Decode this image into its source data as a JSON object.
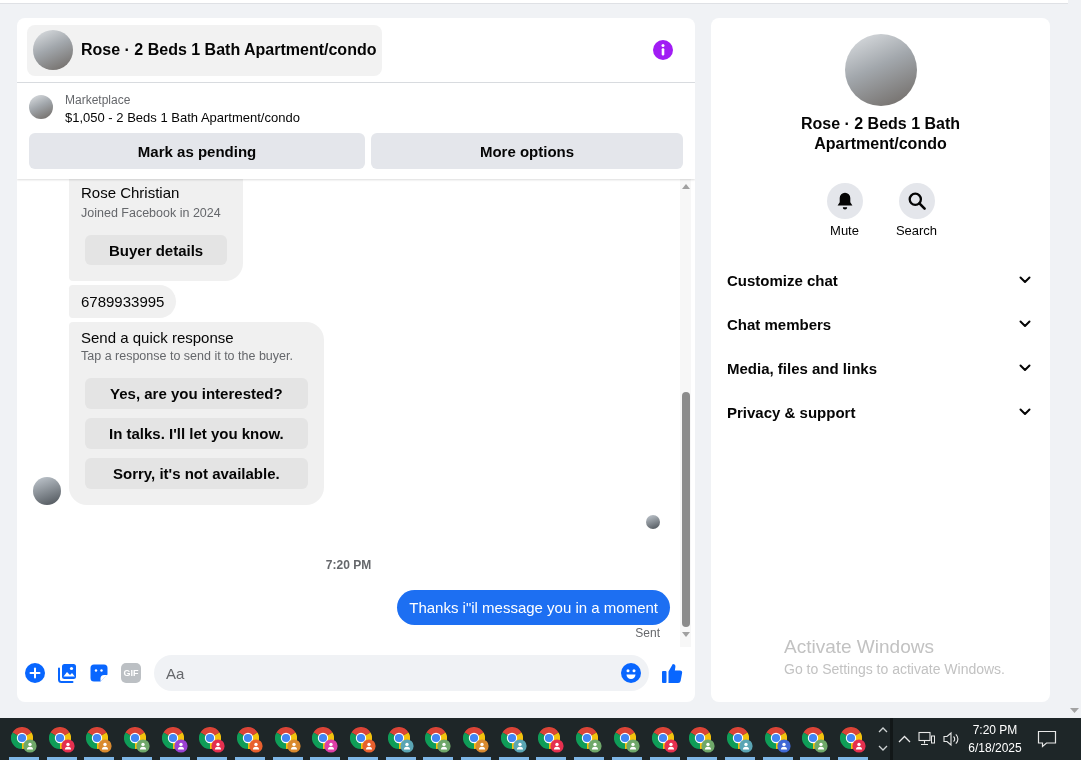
{
  "conversation": {
    "title": "Rose · 2 Beds 1 Bath Apartment/condo"
  },
  "listing": {
    "source": "Marketplace",
    "summary": "$1,050 - 2 Beds 1 Bath Apartment/condo",
    "actions": [
      "Mark as pending",
      "More options"
    ]
  },
  "messages": [
    {
      "kind": "profile_card",
      "outgoing": false,
      "avatar": false,
      "name": "Rose Christian",
      "subtitle": "Joined Facebook in 2024",
      "button": "Buyer details"
    },
    {
      "kind": "text",
      "outgoing": false,
      "avatar": false,
      "text": "6789933995"
    },
    {
      "kind": "quick_responses",
      "outgoing": false,
      "avatar": true,
      "title": "Send a quick response",
      "subtitle": "Tap a response to send it to the buyer.",
      "options": [
        "Yes, are you interested?",
        "In talks. I'll let you know.",
        "Sorry, it's not available."
      ]
    },
    {
      "kind": "seen"
    },
    {
      "kind": "timestamp",
      "text": "7:20 PM"
    },
    {
      "kind": "text",
      "outgoing": true,
      "text": "Thanks i\"il message you in a moment",
      "status": "Sent"
    }
  ],
  "composer": {
    "tools": [
      {
        "kind": "plus",
        "disabled": false
      },
      {
        "kind": "photo",
        "disabled": false
      },
      {
        "kind": "sticker",
        "disabled": false
      },
      {
        "kind": "gif",
        "label": "GIF",
        "disabled": true
      }
    ],
    "placeholder": "Aa"
  },
  "details": {
    "title": "Rose · 2 Beds 1 Bath Apartment/condo",
    "actions": [
      {
        "kind": "mute",
        "label": "Mute"
      },
      {
        "kind": "search",
        "label": "Search"
      }
    ],
    "sections": [
      {
        "label": "Customize chat",
        "expanded": false
      },
      {
        "label": "Chat members",
        "expanded": false
      },
      {
        "label": "Media, files and links",
        "expanded": false
      },
      {
        "label": "Privacy & support",
        "expanded": false
      }
    ]
  },
  "system_notice": {
    "title": "Activate Windows",
    "text": "Go to Settings to activate Windows."
  },
  "taskbar": {
    "apps": [
      {
        "color": "#6fa86a"
      },
      {
        "color": "#e5304f"
      },
      {
        "color": "#d98a2f"
      },
      {
        "color": "#6fa86a"
      },
      {
        "color": "#9b41d3"
      },
      {
        "color": "#e5304f"
      },
      {
        "color": "#e8602e"
      },
      {
        "color": "#d98a2f"
      },
      {
        "color": "#df3ea7"
      },
      {
        "color": "#e8602e"
      },
      {
        "color": "#5aa5b4"
      },
      {
        "color": "#6fa86a"
      },
      {
        "color": "#d98a2f"
      },
      {
        "color": "#5aa5b4"
      },
      {
        "color": "#e5304f"
      },
      {
        "color": "#6fa86a"
      },
      {
        "color": "#6fa86a"
      },
      {
        "color": "#e5304f"
      },
      {
        "color": "#6fa86a"
      },
      {
        "color": "#5aa5b4"
      },
      {
        "color": "#4069d6"
      },
      {
        "color": "#6fa86a"
      },
      {
        "color": "#e5304f"
      }
    ],
    "clock": {
      "time": "7:20 PM",
      "date": "6/18/2025"
    }
  }
}
